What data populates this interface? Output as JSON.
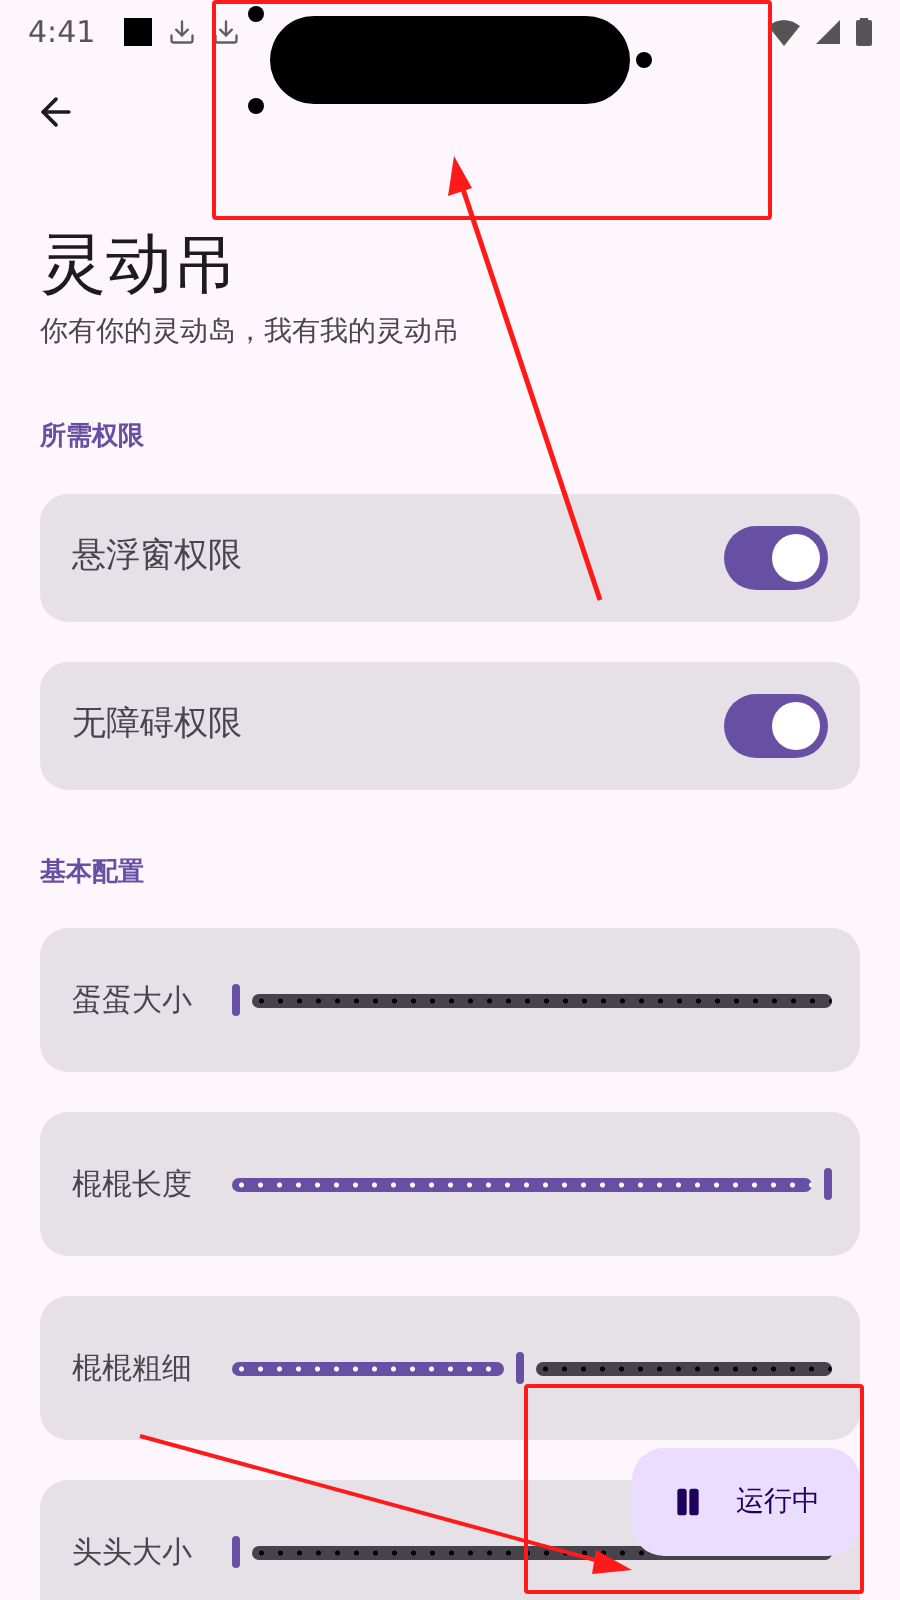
{
  "status_bar": {
    "time": "4:41"
  },
  "title": "灵动吊",
  "subtitle": "你有你的灵动岛，我有我的灵动吊",
  "sections": [
    {
      "title": "所需权限",
      "items": [
        {
          "kind": "switch",
          "label": "悬浮窗权限",
          "on": true
        },
        {
          "kind": "switch",
          "label": "无障碍权限",
          "on": true
        }
      ]
    },
    {
      "title": "基本配置",
      "items": [
        {
          "kind": "slider",
          "label": "蛋蛋大小",
          "level": 0
        },
        {
          "kind": "slider",
          "label": "棍棍长度",
          "level": 1
        },
        {
          "kind": "slider",
          "label": "棍棍粗细",
          "level": 0.48
        },
        {
          "kind": "slider",
          "label": "头头大小",
          "level": 0
        }
      ]
    }
  ],
  "fab": {
    "label": "运行中"
  }
}
